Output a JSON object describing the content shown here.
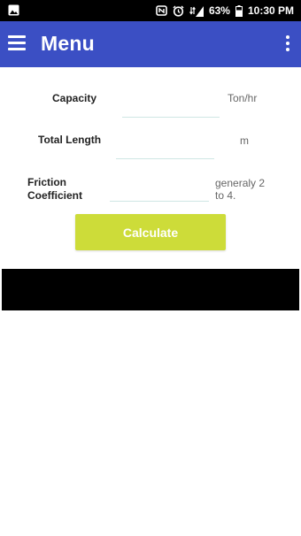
{
  "status_bar": {
    "battery": "63%",
    "time": "10:30 PM"
  },
  "app_bar": {
    "title": "Menu"
  },
  "form": {
    "capacity": {
      "label": "Capacity",
      "unit": "Ton/hr",
      "value": ""
    },
    "total_length": {
      "label": "Total Length",
      "unit": "m",
      "value": ""
    },
    "friction": {
      "label_line1": "Friction",
      "label_line2": "Coefficient",
      "unit_line1": "generaly 2",
      "unit_line2": "to 4.",
      "value": ""
    }
  },
  "calculate_label": "Calculate",
  "colors": {
    "app_bar": "#3b4fc4",
    "button": "#cddc39",
    "field_underline": "#cfe7e4"
  }
}
